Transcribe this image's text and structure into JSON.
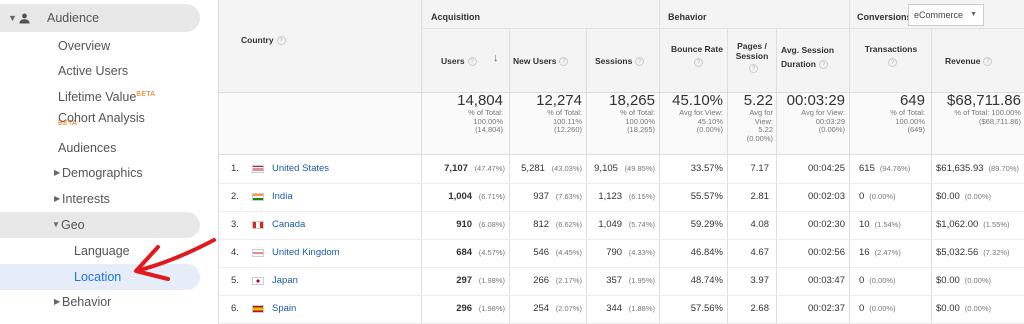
{
  "sidebar": {
    "audience": "Audience",
    "overview": "Overview",
    "active_users": "Active Users",
    "lifetime_value": "Lifetime Value",
    "lifetime_beta": "BETA",
    "cohort": "Cohort Analysis",
    "cohort_beta": "BETA",
    "audiences": "Audiences",
    "demographics": "Demographics",
    "interests": "Interests",
    "geo": "Geo",
    "language": "Language",
    "location": "Location",
    "behavior": "Behavior"
  },
  "table": {
    "dimension_header": "Country",
    "groups": {
      "acquisition": "Acquisition",
      "behavior": "Behavior",
      "conversions": "Conversions"
    },
    "conversion_select": "eCommerce",
    "columns": {
      "users": "Users",
      "new_users": "New Users",
      "sessions": "Sessions",
      "bounce_rate": "Bounce Rate",
      "pages_session_1": "Pages /",
      "pages_session_2": "Session",
      "avg_session_1": "Avg. Session",
      "avg_session_2": "Duration",
      "transactions": "Transactions",
      "revenue": "Revenue"
    },
    "totals": {
      "users": {
        "value": "14,804",
        "note": "% of Total:\n100.00%\n(14,804)"
      },
      "new_users": {
        "value": "12,274",
        "note": "% of Total:\n100.11%\n(12,260)"
      },
      "sessions": {
        "value": "18,265",
        "note": "% of Total:\n100.00%\n(18,265)"
      },
      "bounce_rate": {
        "value": "45.10%",
        "note": "Avg for View:\n45.10%\n(0.00%)"
      },
      "pages_session": {
        "value": "5.22",
        "note": "Avg for\nView:\n5.22\n(0.00%)"
      },
      "avg_session": {
        "value": "00:03:29",
        "note": "Avg for View:\n00:03:29\n(0.00%)"
      },
      "transactions": {
        "value": "649",
        "note": "% of Total:\n100.00%\n(649)"
      },
      "revenue": {
        "value": "$68,711.86",
        "note": "% of Total: 100.00%\n($68,711.86)"
      }
    },
    "rows": [
      {
        "idx": "1.",
        "country": "United States",
        "users": "7,107",
        "users_pct": "(47.47%)",
        "new_users": "5,281",
        "new_users_pct": "(43.03%)",
        "sessions": "9,105",
        "sessions_pct": "(49.85%)",
        "bounce": "33.57%",
        "pages": "7.17",
        "duration": "00:04:25",
        "trans": "615",
        "trans_pct": "(94.76%)",
        "revenue": "$61,635.93",
        "revenue_pct": "(89.70%)"
      },
      {
        "idx": "2.",
        "country": "India",
        "users": "1,004",
        "users_pct": "(6.71%)",
        "new_users": "937",
        "new_users_pct": "(7.63%)",
        "sessions": "1,123",
        "sessions_pct": "(6.15%)",
        "bounce": "55.57%",
        "pages": "2.81",
        "duration": "00:02:03",
        "trans": "0",
        "trans_pct": "(0.00%)",
        "revenue": "$0.00",
        "revenue_pct": "(0.00%)"
      },
      {
        "idx": "3.",
        "country": "Canada",
        "users": "910",
        "users_pct": "(6.08%)",
        "new_users": "812",
        "new_users_pct": "(6.62%)",
        "sessions": "1,049",
        "sessions_pct": "(5.74%)",
        "bounce": "59.29%",
        "pages": "4.08",
        "duration": "00:02:30",
        "trans": "10",
        "trans_pct": "(1.54%)",
        "revenue": "$1,062.00",
        "revenue_pct": "(1.55%)"
      },
      {
        "idx": "4.",
        "country": "United Kingdom",
        "users": "684",
        "users_pct": "(4.57%)",
        "new_users": "546",
        "new_users_pct": "(4.45%)",
        "sessions": "790",
        "sessions_pct": "(4.33%)",
        "bounce": "46.84%",
        "pages": "4.67",
        "duration": "00:02:56",
        "trans": "16",
        "trans_pct": "(2.47%)",
        "revenue": "$5,032.56",
        "revenue_pct": "(7.32%)"
      },
      {
        "idx": "5.",
        "country": "Japan",
        "users": "297",
        "users_pct": "(1.98%)",
        "new_users": "266",
        "new_users_pct": "(2.17%)",
        "sessions": "357",
        "sessions_pct": "(1.95%)",
        "bounce": "48.74%",
        "pages": "3.97",
        "duration": "00:03:47",
        "trans": "0",
        "trans_pct": "(0.00%)",
        "revenue": "$0.00",
        "revenue_pct": "(0.00%)"
      },
      {
        "idx": "6.",
        "country": "Spain",
        "users": "296",
        "users_pct": "(1.98%)",
        "new_users": "254",
        "new_users_pct": "(2.07%)",
        "sessions": "344",
        "sessions_pct": "(1.88%)",
        "bounce": "57.56%",
        "pages": "2.68",
        "duration": "00:02:37",
        "trans": "0",
        "trans_pct": "(0.00%)",
        "revenue": "$0.00",
        "revenue_pct": "(0.00%)"
      }
    ]
  },
  "annotation": {
    "arrow_color": "#e0191f"
  },
  "colors": {
    "link": "#1a5ba8",
    "selected_bg": "#e6edf9",
    "selected_text": "#1a73e8",
    "beta": "#e8710a"
  }
}
